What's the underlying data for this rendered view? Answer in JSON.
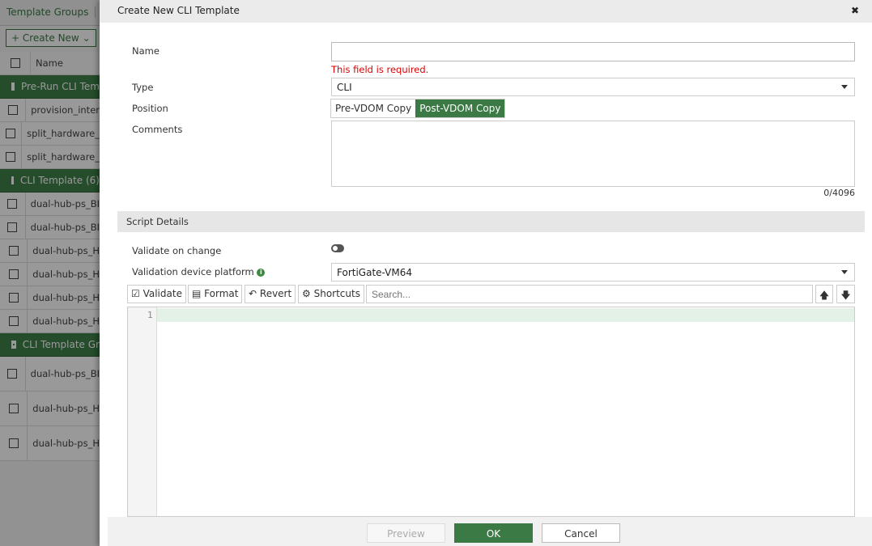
{
  "background": {
    "tab": "Template Groups",
    "create_new": "Create New",
    "name_header": "Name",
    "rows": [
      {
        "type": "group",
        "label": "Pre-Run CLI Tem"
      },
      {
        "type": "item",
        "label": "provision_inter"
      },
      {
        "type": "item",
        "label": "split_hardware_"
      },
      {
        "type": "item",
        "label": "split_hardware_"
      },
      {
        "type": "group",
        "label": "CLI Template (6)"
      },
      {
        "type": "item",
        "label": "dual-hub-ps_BI"
      },
      {
        "type": "item",
        "label": "dual-hub-ps_BI"
      },
      {
        "type": "item",
        "label": "dual-hub-ps_H"
      },
      {
        "type": "item",
        "label": "dual-hub-ps_H"
      },
      {
        "type": "item",
        "label": "dual-hub-ps_H"
      },
      {
        "type": "item",
        "label": "dual-hub-ps_H"
      },
      {
        "type": "group",
        "label": "CLI Template Gr"
      },
      {
        "type": "tall",
        "label": "dual-hub-ps_BI"
      },
      {
        "type": "tall",
        "label": "dual-hub-ps_H"
      },
      {
        "type": "tall",
        "label": "dual-hub-ps_H"
      }
    ]
  },
  "modal": {
    "title": "Create New CLI Template",
    "close": "✖",
    "name_label": "Name",
    "name_value": "",
    "name_error": "This field is required.",
    "type_label": "Type",
    "type_value": "CLI",
    "position_label": "Position",
    "position_options": [
      "Pre-VDOM Copy",
      "Post-VDOM Copy"
    ],
    "comments_label": "Comments",
    "comments_count": "0/4096",
    "section": "Script Details",
    "validate_on_change": "Validate on change",
    "platform_label": "Validation device platform",
    "platform_value": "FortiGate-VM64",
    "toolbar": {
      "validate": "Validate",
      "format": "Format",
      "revert": "Revert",
      "shortcuts": "Shortcuts",
      "search_placeholder": "Search..."
    },
    "line_number": "1",
    "preview": "Preview",
    "ok": "OK",
    "cancel": "Cancel"
  },
  "colors": {
    "accent": "#3b7a44",
    "error": "#dd0000"
  }
}
